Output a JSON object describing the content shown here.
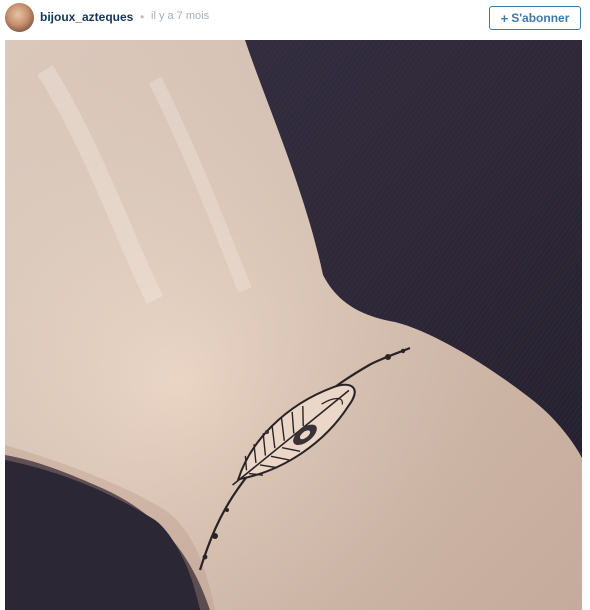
{
  "post": {
    "username": "bijoux_azteques",
    "separator": "•",
    "timestamp": "il y a 7 mois",
    "follow_button": {
      "icon": "plus-icon",
      "icon_glyph": "+",
      "label": "S'abonner"
    },
    "photo": {
      "kind": "photo of a feather bracelet tattoo on a wrist"
    }
  },
  "colors": {
    "username": "#12375b",
    "meta": "#a5adb5",
    "button_border": "#3f79a8",
    "background": "#ffffff"
  }
}
